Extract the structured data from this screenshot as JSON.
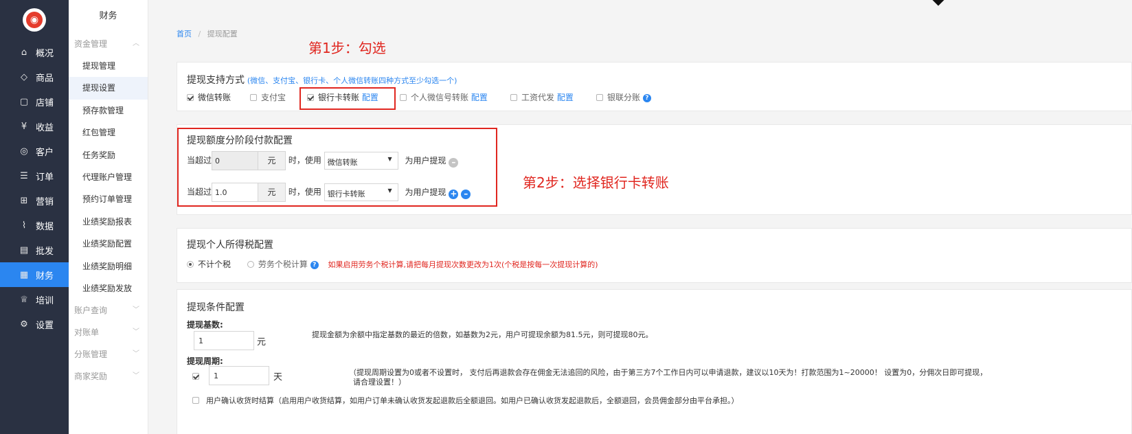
{
  "sidebar": {
    "logo_glyph": "◉",
    "items": [
      {
        "icon": "home-icon",
        "glyph": "⌂",
        "label": "概况"
      },
      {
        "icon": "tag-icon",
        "glyph": "◇",
        "label": "商品"
      },
      {
        "icon": "store-icon",
        "glyph": "▢",
        "label": "店铺"
      },
      {
        "icon": "yen-icon",
        "glyph": "¥",
        "label": "收益"
      },
      {
        "icon": "customer-icon",
        "glyph": "◎",
        "label": "客户"
      },
      {
        "icon": "order-icon",
        "glyph": "☰",
        "label": "订单"
      },
      {
        "icon": "marketing-icon",
        "glyph": "⊞",
        "label": "营销"
      },
      {
        "icon": "data-icon",
        "glyph": "⌇",
        "label": "数据"
      },
      {
        "icon": "wholesale-icon",
        "glyph": "▤",
        "label": "批发"
      },
      {
        "icon": "finance-icon",
        "glyph": "▦",
        "label": "财务",
        "active": true
      },
      {
        "icon": "training-icon",
        "glyph": "♕",
        "label": "培训"
      },
      {
        "icon": "settings-icon",
        "glyph": "⚙",
        "label": "设置"
      }
    ]
  },
  "subnav": {
    "title": "财务",
    "group_funds": "资金管理",
    "items": [
      "提现管理",
      "提现设置",
      "预存款管理",
      "红包管理",
      "任务奖励",
      "代理账户管理",
      "预约订单管理",
      "业绩奖励报表",
      "业绩奖励配置",
      "业绩奖励明细",
      "业绩奖励发放"
    ],
    "groups_after": [
      "账户查询",
      "对账单",
      "分账管理",
      "商家奖励"
    ]
  },
  "breadcrumb": {
    "home": "首页",
    "sep": "/",
    "current": "提现配置"
  },
  "annotations": {
    "step1": "第1步：勾选",
    "step2": "第2步：选择银行卡转账"
  },
  "methods": {
    "title": "提现支持方式",
    "hint": "(微信、支付宝、银行卡、个人微信转账四种方式至少勾选一个)",
    "options": [
      {
        "label": "微信转账",
        "checked": true
      },
      {
        "label": "支付宝",
        "checked": false
      },
      {
        "label": "银行卡转账",
        "checked": true,
        "link": "配置"
      },
      {
        "label": "个人微信号转账",
        "checked": false,
        "link": "配置"
      },
      {
        "label": "工资代发",
        "checked": false,
        "link": "配置"
      },
      {
        "label": "银联分账",
        "checked": false
      }
    ],
    "help_glyph": "?"
  },
  "tiers": {
    "title": "提现额度分阶段付款配置",
    "prefix": "当超过",
    "unit": "元",
    "mid": "时，使用",
    "suffix": "为用户提现",
    "rows": [
      {
        "amount": "0",
        "method": "微信转账"
      },
      {
        "amount": "1.0",
        "method": "银行卡转账"
      }
    ]
  },
  "tax": {
    "title": "提现个人所得税配置",
    "opt_none": "不计个税",
    "opt_labor": "劳务个税计算",
    "warning": "如果启用劳务个税计算,请把每月提现次数更改为1次(个税是按每一次提现计算的)"
  },
  "conditions": {
    "title": "提现条件配置",
    "base_label": "提现基数:",
    "base_value": "1",
    "base_unit": "元",
    "base_desc": "提现金额为余额中指定基数的最近的倍数，如基数为2元，用户可提现余额为81.5元，则可提现80元。",
    "period_label": "提现周期:",
    "period_value": "1",
    "period_unit": "天",
    "period_desc1": "（提现周期设置为0或者不设置时，  支付后再退款会存在佣金无法追回的风险，由于第三方7个工作日内可以申请退款，建议以10天为！打款范围为1~20000！ 设置为0，分佣次日即可提现，",
    "period_desc2": "请合理设置！）",
    "confirm_text": "用户确认收货时结算（启用用户收货结算，如用户订单未确认收货发起退款后全额退回。如用户已确认收货发起退款后，全额退回，会员佣金部分由平台承担。）"
  },
  "colors": {
    "sidebar_bg": "#2a3142",
    "active": "#2b86f0",
    "annotation_red": "#e0261f"
  }
}
